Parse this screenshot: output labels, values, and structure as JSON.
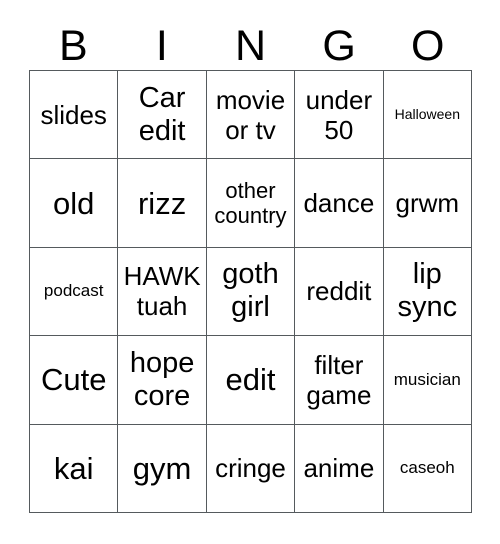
{
  "card": {
    "title_letters": [
      "B",
      "I",
      "N",
      "G",
      "O"
    ],
    "columns": 5,
    "rows": 5,
    "grid_line_color": "#555a5d",
    "background_color": "#ffffff",
    "text_color": "#000000",
    "cells": [
      [
        {
          "text": "slides",
          "size": "md"
        },
        {
          "text": "Car\nedit",
          "size": "lg"
        },
        {
          "text": "movie\nor tv",
          "size": "md"
        },
        {
          "text": "under\n50",
          "size": "md"
        },
        {
          "text": "Halloween",
          "size": "xxs"
        }
      ],
      [
        {
          "text": "old",
          "size": "xl"
        },
        {
          "text": "rizz",
          "size": "xl"
        },
        {
          "text": "other\ncountry",
          "size": "sm"
        },
        {
          "text": "dance",
          "size": "md"
        },
        {
          "text": "grwm",
          "size": "md"
        }
      ],
      [
        {
          "text": "podcast",
          "size": "xs"
        },
        {
          "text": "HAWK\ntuah",
          "size": "md"
        },
        {
          "text": "goth\ngirl",
          "size": "lg"
        },
        {
          "text": "reddit",
          "size": "md"
        },
        {
          "text": "lip\nsync",
          "size": "lg"
        }
      ],
      [
        {
          "text": "Cute",
          "size": "xl"
        },
        {
          "text": "hope\ncore",
          "size": "lg"
        },
        {
          "text": "edit",
          "size": "xl"
        },
        {
          "text": "filter\ngame",
          "size": "md"
        },
        {
          "text": "musician",
          "size": "xs"
        }
      ],
      [
        {
          "text": "kai",
          "size": "xl"
        },
        {
          "text": "gym",
          "size": "xl"
        },
        {
          "text": "cringe",
          "size": "md"
        },
        {
          "text": "anime",
          "size": "md"
        },
        {
          "text": "caseoh",
          "size": "xs"
        }
      ]
    ]
  }
}
